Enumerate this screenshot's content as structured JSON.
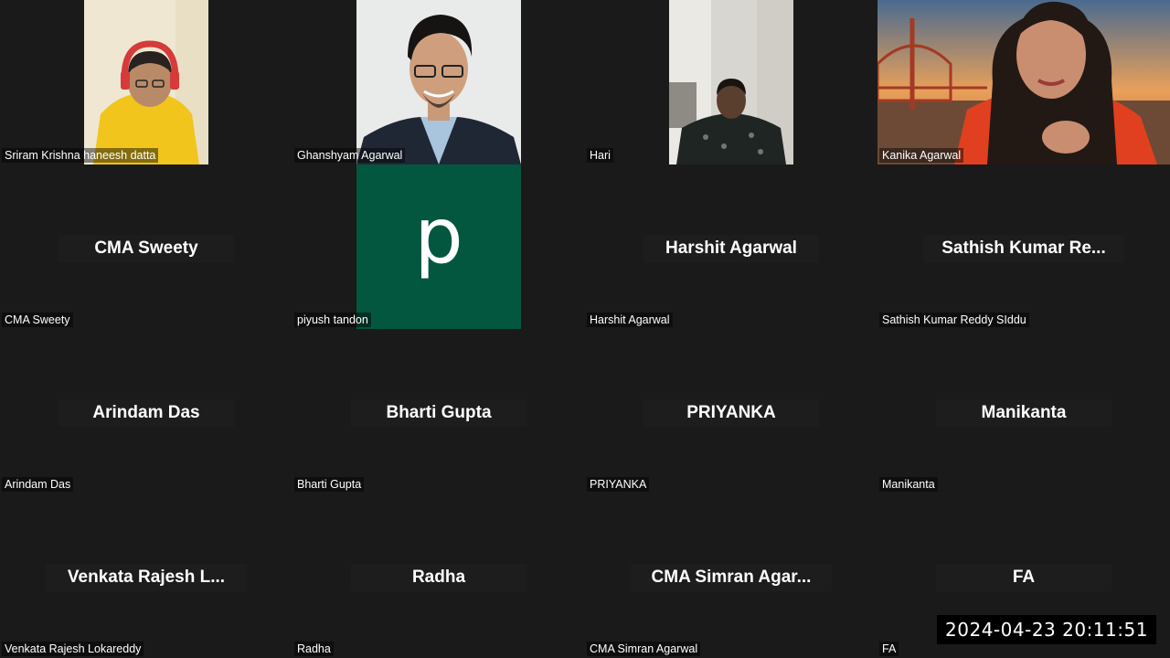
{
  "tiles": [
    {
      "label": "Sriram Krishna haneesh datta"
    },
    {
      "label": "Ghanshyam Agarwal"
    },
    {
      "label": "Hari"
    },
    {
      "label": "Kanika Agarwal"
    },
    {
      "big": "CMA Sweety",
      "label": "CMA Sweety"
    },
    {
      "avatar_letter": "p",
      "label": "piyush tandon"
    },
    {
      "big": "Harshit Agarwal",
      "label": "Harshit Agarwal"
    },
    {
      "big": "Sathish Kumar Re...",
      "label": "Sathish Kumar Reddy SIddu"
    },
    {
      "big": "Arindam Das",
      "label": "Arindam Das"
    },
    {
      "big": "Bharti Gupta",
      "label": "Bharti Gupta"
    },
    {
      "big": "PRIYANKA",
      "label": "PRIYANKA"
    },
    {
      "big": "Manikanta",
      "label": "Manikanta"
    },
    {
      "big": "Venkata Rajesh L...",
      "label": "Venkata Rajesh Lokareddy"
    },
    {
      "big": "Radha",
      "label": "Radha"
    },
    {
      "big": "CMA Simran Agar...",
      "label": "CMA Simran Agarwal"
    },
    {
      "big": "FA",
      "label": "FA"
    }
  ],
  "timestamp": "2024-04-23  20:11:51",
  "colors": {
    "background": "#1a1a1a",
    "avatar_green": "#03573f"
  }
}
